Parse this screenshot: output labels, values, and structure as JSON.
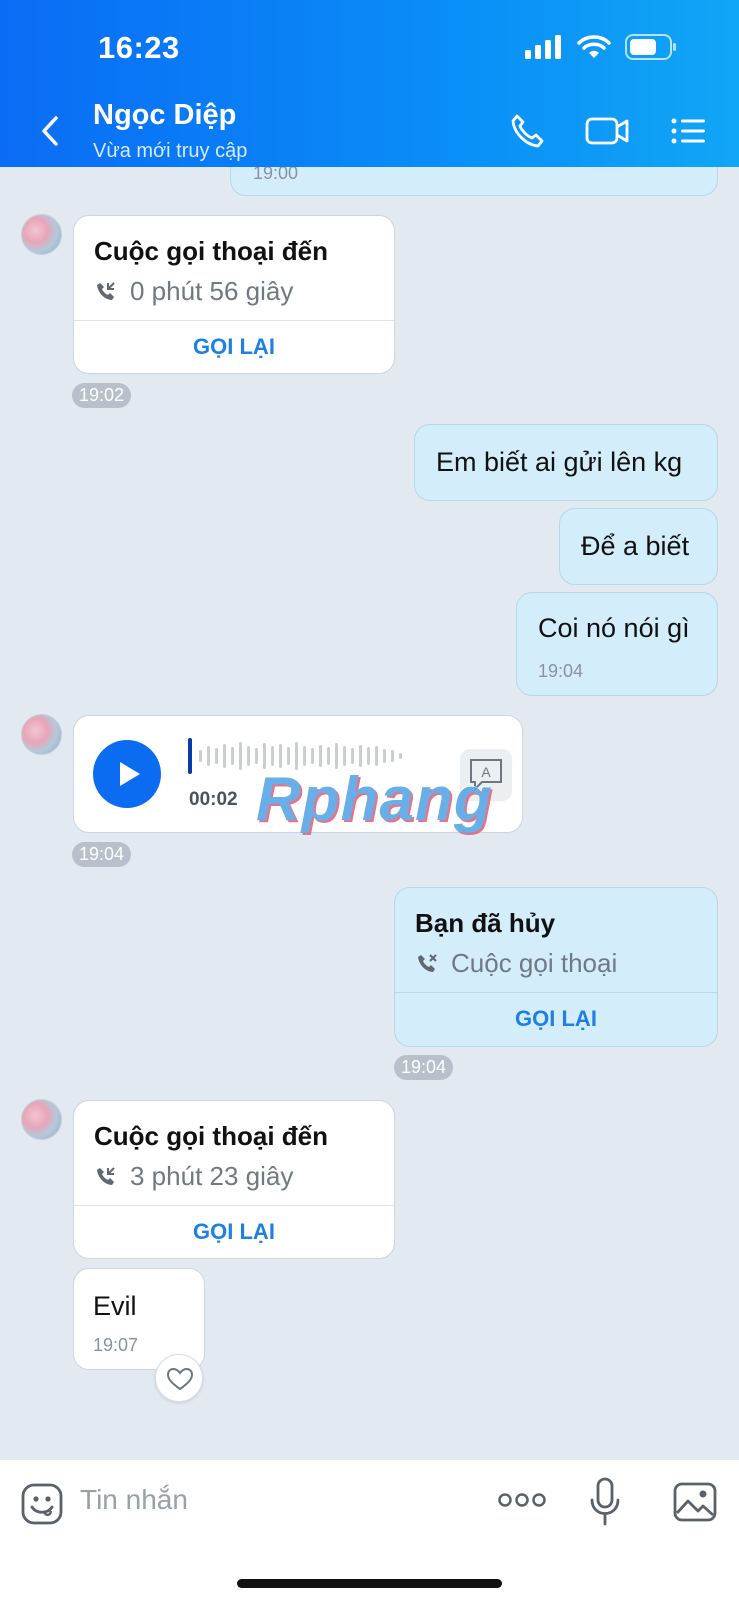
{
  "status_bar": {
    "time": "16:23"
  },
  "header": {
    "name": "Ngọc Diệp",
    "status": "Vừa mới truy cập"
  },
  "messages": {
    "prev_time": "19:00",
    "call1": {
      "title": "Cuộc gọi thoại đến",
      "duration": "0 phút 56 giây",
      "action": "GỌI LẠI",
      "time": "19:02"
    },
    "out1": {
      "text": "Em biết ai gửi lên kg"
    },
    "out2": {
      "text": "Để a biết"
    },
    "out3": {
      "text": "Coi nó nói gì",
      "time": "19:04"
    },
    "voice": {
      "duration": "00:02",
      "time": "19:04",
      "transcribe_icon": "A"
    },
    "cancelled": {
      "title": "Bạn đã hủy",
      "sub": "Cuộc gọi thoại",
      "action": "GỌI LẠI",
      "time": "19:04"
    },
    "call2": {
      "title": "Cuộc gọi thoại đến",
      "duration": "3 phút 23 giây",
      "action": "GỌI LẠI"
    },
    "in_text": {
      "text": "Evil",
      "time": "19:07"
    }
  },
  "watermark": "Rphang",
  "composer": {
    "placeholder": "Tin nhắn"
  },
  "colors": {
    "header": "#0a8df7",
    "accent": "#1e7fe5",
    "play": "#0b6cf2",
    "outgoing_bubble": "#d4edfb"
  }
}
